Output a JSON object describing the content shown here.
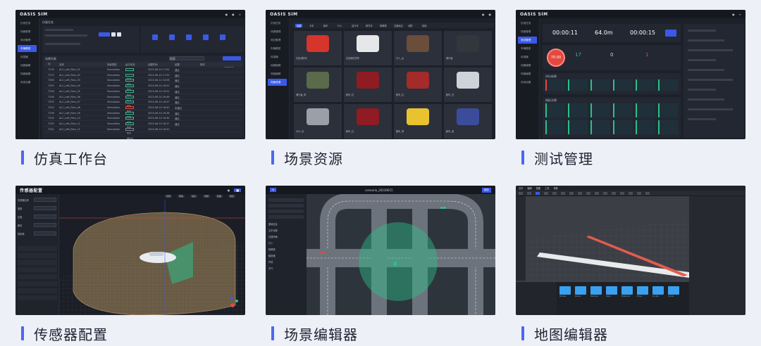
{
  "cards": [
    {
      "caption": "仿真工作台"
    },
    {
      "caption": "场景资源"
    },
    {
      "caption": "测试管理"
    },
    {
      "caption": "传感器配置"
    },
    {
      "caption": "场景编辑器"
    },
    {
      "caption": "地图编辑器"
    }
  ],
  "app": {
    "logo": "OASIS SIM"
  },
  "workbench": {
    "sidebar": [
      "仿真任务",
      "场景管理",
      "测试管理",
      "车辆模型",
      "传感器",
      "地图编辑",
      "场景编辑",
      "系统设置"
    ],
    "active": 3,
    "section_title": "仿真任务",
    "list_title": "场景列表",
    "search_placeholder": "搜索",
    "create_label": "新建仿真",
    "columns": [
      "ID",
      "名称",
      "场景类型",
      "运行状态",
      "创建时间",
      "结果",
      "操作"
    ],
    "rows": [
      [
        "7276",
        "ALC_Left_Rkrs_01",
        "Simulation",
        "成功",
        "2023-06-14 17:00",
        "通过"
      ],
      [
        "7275",
        "ALC_Left_Rkrs_02",
        "Simulation",
        "成功",
        "2023-06-14 17:00",
        "通过"
      ],
      [
        "7260",
        "ALC_Left_Rkrs_03",
        "Simulation",
        "成功",
        "2023-06-14 16:58",
        "通过"
      ],
      [
        "7259",
        "ALC_Left_Rkrs_04",
        "Simulation",
        "成功",
        "2023-06-14 16:52",
        "通过"
      ],
      [
        "7258",
        "ALC_Left_Rkrs_05",
        "Simulation",
        "成功",
        "2023-06-14 16:51",
        "通过"
      ],
      [
        "7256",
        "ALC_Left_Rkrs_06",
        "Simulation",
        "成功",
        "2023-06-14 16:48",
        "通过"
      ],
      [
        "7255",
        "ALC_Left_Rkrs_07",
        "Simulation",
        "成功",
        "2023-06-14 16:47",
        "通过"
      ],
      [
        "7253",
        "ALC_Left_Rkrs_08",
        "Simulation",
        "失败",
        "2023-06-14 16:40",
        "未通过"
      ],
      [
        "7236",
        "ALC_Left_Rkrs_09",
        "Simulation",
        "成功",
        "2023-06-14 16:36",
        "通过"
      ],
      [
        "7234",
        "ALC_Left_Rkrs_10",
        "Simulation",
        "成功",
        "2023-06-14 16:30",
        "通过"
      ],
      [
        "7233",
        "ALC_Left_Rkrs_11",
        "Simulation",
        "成功",
        "2023-06-14 16:27",
        "通过"
      ],
      [
        "7232",
        "ALC_Left_Rkrs_12",
        "Simulation",
        "排队中",
        "2023-06-14 16:20",
        ""
      ]
    ]
  },
  "resources": {
    "sidebar": [
      "仿真任务",
      "场景管理",
      "测试管理",
      "车辆模型",
      "传感器",
      "地图编辑",
      "场景编辑",
      "场景资源"
    ],
    "active": 7,
    "tabs": [
      "全部",
      "卡车",
      "轿车",
      "行人",
      "自行车",
      "摩托车",
      "障碍物",
      "交通标志",
      "动物",
      "其他"
    ],
    "items": [
      "红色消防车",
      "白色厢式货车",
      "行人_女",
      "骑行者",
      "骑行者_男",
      "轿车_红",
      "轿车_红",
      "轿车_白",
      "SUV_灰",
      "轿车_红",
      "跑车_黄",
      "轿车_蓝"
    ]
  },
  "testing": {
    "timer1": "00:00:11",
    "distance": "64.0m",
    "timer2": "00:00:15",
    "score": "70.00",
    "stats": [
      "17",
      "0",
      "1"
    ],
    "section1": "评价结果",
    "section2": "指标详情"
  },
  "sensor": {
    "title": "传感器配置",
    "fields": [
      "传感器名称",
      "类型",
      "位置",
      "朝向",
      "视场角"
    ],
    "toolbar": [
      "视角",
      "网格",
      "坐标",
      "测量",
      "截图",
      "重置"
    ]
  },
  "editor": {
    "title": "scenario_20230615",
    "save": "保存",
    "sidebar": [
      "基础信息",
      "主车设置",
      "交通车辆",
      "行人",
      "障碍物",
      "触发器",
      "环境",
      "天气"
    ]
  },
  "mapeditor": {
    "menu": [
      "文件",
      "编辑",
      "视图",
      "工具",
      "帮助"
    ],
    "folders": [
      "Models",
      "Roads",
      "Textures",
      "Signs",
      "Materials",
      "Props",
      "Scripts",
      "Terrain"
    ]
  },
  "colors": {
    "accent": "#4a68f0",
    "bg": "#eef0f8",
    "panel": "#1c2029",
    "green": "#2dbe8a",
    "red": "#e5483e"
  }
}
